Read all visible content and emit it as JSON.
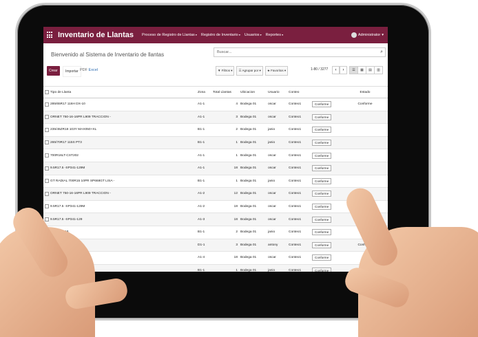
{
  "app": {
    "title": "Inventario de Llantas",
    "menu": [
      "Proceso de Registro de Llantas",
      "Registro de Inventario",
      "Usuarios",
      "Reportes"
    ],
    "user": "Administrator"
  },
  "control": {
    "breadcrumb": "Bienvenido al Sistema de Inventario de llantas",
    "search_placeholder": "Buscar...",
    "create_label": "Crear",
    "import_label": "Importar",
    "pdf_label": "PDF",
    "excel_label": "Excel",
    "filters_label": "Filtros",
    "group_label": "Agrupar por",
    "favorites_label": "Favoritos",
    "pager": "1-80 / 3277",
    "prev": "‹",
    "next": "›"
  },
  "table": {
    "headers": [
      "Tipo de Llanta",
      "Zona",
      "Total Llantas",
      "Ubicacion",
      "Usuario",
      "Conteo",
      "",
      "Estado"
    ],
    "rows": [
      [
        "285/65R17 116H DX-10",
        "A1-1",
        "4",
        "Bodega 01",
        "oscar",
        "Conteo1",
        "Conforme",
        "Conforme"
      ],
      [
        "ORNET 750-16-16PR L909 TRACCION -",
        "A1-1",
        "3",
        "Bodega 01",
        "oscar",
        "Conteo1",
        "Conforme",
        ""
      ],
      [
        "235/45ZR18 103Y MAX050+XL",
        "B1-1",
        "2",
        "Bodega 01",
        "janio",
        "Conteo1",
        "Conforme",
        ""
      ],
      [
        "265/70R17 115S PT3",
        "B1-1",
        "1",
        "Bodega 01",
        "janio",
        "Conteo1",
        "Conforme",
        ""
      ],
      [
        "700R16LT-CST202",
        "A1-1",
        "1",
        "Bodega 01",
        "oscar",
        "Conteo1",
        "Conforme",
        ""
      ],
      [
        "9.5R17.5 -SP341-129M",
        "A1-1",
        "18",
        "Bodega 01",
        "oscar",
        "Conteo1",
        "Conforme",
        ""
      ],
      [
        "GT RADIAL 700R15 10PR SP668GT LISA -",
        "B1-1",
        "1",
        "Bodega 01",
        "janio",
        "Conteo1",
        "Conforme",
        ""
      ],
      [
        "ORNET 750-16-16PR L909 TRACCION -",
        "A1-2",
        "12",
        "Bodega 01",
        "oscar",
        "Conteo1",
        "Conforme",
        ""
      ],
      [
        "9.5R17.5 -SP341-129M",
        "A1-2",
        "18",
        "Bodega 01",
        "oscar",
        "Conteo1",
        "Conforme",
        ""
      ],
      [
        "9.5R17.5 -SP341-129",
        "A1-3",
        "18",
        "Bodega 01",
        "oscar",
        "Conteo1",
        "Conforme",
        ""
      ],
      [
        "255/45ZR18",
        "B1-1",
        "2",
        "Bodega 01",
        "janio",
        "Conteo1",
        "Conforme",
        ""
      ],
      [
        "GT R",
        "D1-1",
        "3",
        "Bodega 01",
        "antony",
        "Conteo1",
        "Conforme",
        "Conforme"
      ],
      [
        "M",
        "A1-4",
        "18",
        "Bodega 01",
        "oscar",
        "Conteo1",
        "Conforme",
        ""
      ],
      [
        "1T AT3 OW 01 GDEEI",
        "B1-1",
        "1",
        "Bodega 01",
        "janio",
        "Conteo1",
        "Conforme",
        ""
      ]
    ]
  },
  "colors": {
    "brand": "#7a1f3f"
  }
}
